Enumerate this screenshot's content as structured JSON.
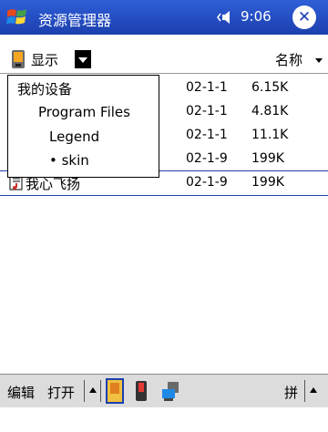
{
  "titlebar": {
    "title": "资源管理器",
    "time": "9:06"
  },
  "toolbar": {
    "show_label": "显示",
    "sort_label": "名称"
  },
  "folder_menu": {
    "items": [
      "我的设备",
      "Program Files",
      "Legend",
      "• skin"
    ]
  },
  "files": [
    {
      "date": "02-1-1",
      "size": "6.15K"
    },
    {
      "date": "02-1-1",
      "size": "4.81K"
    },
    {
      "date": "02-1-1",
      "size": "11.1K"
    },
    {
      "date": "02-1-9",
      "size": "199K"
    },
    {
      "name": "我心飞扬",
      "date": "02-1-9",
      "size": "199K"
    }
  ],
  "cmdbar": {
    "edit_label": "编辑",
    "open_label": "打开",
    "ime_label": "拼"
  }
}
